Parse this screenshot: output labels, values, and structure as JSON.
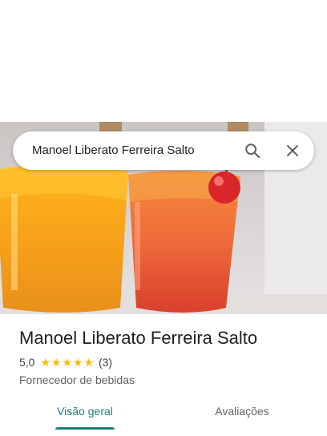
{
  "search": {
    "query": "Manoel Liberato Ferreira Salto",
    "search_icon": "search-icon",
    "close_icon": "close-icon"
  },
  "place": {
    "name": "Manoel Liberato Ferreira Salto",
    "rating": "5,0",
    "stars": 5,
    "review_count": "(3)",
    "category": "Fornecedor de bebidas"
  },
  "tabs": [
    {
      "label": "Visão geral",
      "active": true
    },
    {
      "label": "Avaliações",
      "active": false
    }
  ],
  "colors": {
    "accent": "#1a7f7b",
    "star": "#fbbc04"
  }
}
